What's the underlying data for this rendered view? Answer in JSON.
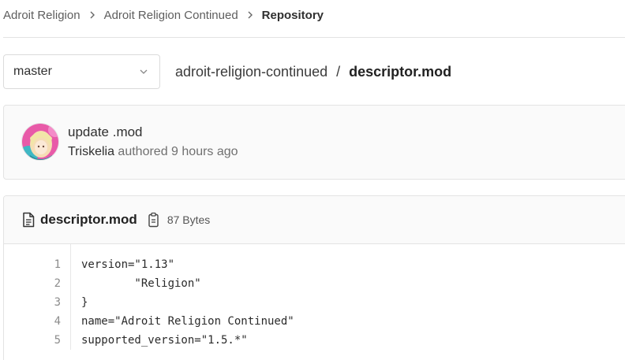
{
  "breadcrumb": {
    "items": [
      {
        "label": "Adroit Religion"
      },
      {
        "label": "Adroit Religion Continued"
      },
      {
        "label": "Repository"
      }
    ]
  },
  "branch_selector": {
    "value": "master"
  },
  "file_path": {
    "directory": "adroit-religion-continued",
    "separator": "/",
    "file": "descriptor.mod"
  },
  "commit": {
    "title": "update .mod",
    "author": "Triskelia",
    "action": "authored",
    "time": "9 hours ago"
  },
  "file": {
    "name": "descriptor.mod",
    "size": "87 Bytes",
    "lines": [
      {
        "number": "1",
        "text": "version=\"1.13\""
      },
      {
        "number": "2",
        "text": "        \"Religion\""
      },
      {
        "number": "3",
        "text": "}"
      },
      {
        "number": "4",
        "text": "name=\"Adroit Religion Continued\""
      },
      {
        "number": "5",
        "text": "supported_version=\"1.5.*\""
      }
    ]
  },
  "icons": {
    "breadcrumb_separator": "chevron-right-icon",
    "branch_dropdown": "chevron-down-icon",
    "file": "file-text-icon",
    "copy": "copy-to-clipboard-icon"
  }
}
